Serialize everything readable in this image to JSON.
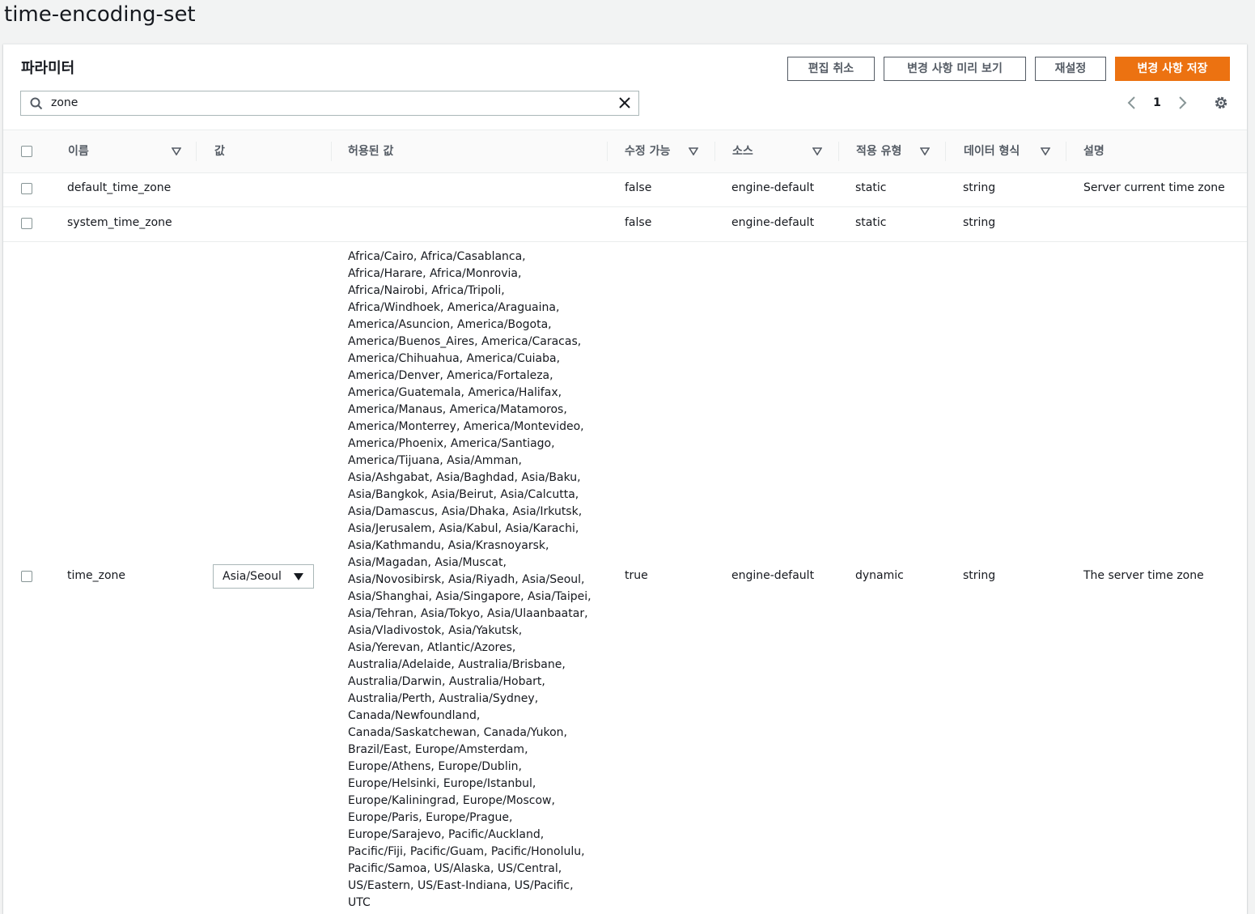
{
  "page": {
    "title": "time-encoding-set"
  },
  "panel": {
    "title": "파라미터",
    "buttons": {
      "cancel_edit": "편집 취소",
      "preview_changes": "변경 사항 미리 보기",
      "reset": "재설정",
      "save_changes": "변경 사항 저장"
    },
    "search": {
      "value": "zone",
      "icon": "search-icon",
      "clear_icon": "close-icon"
    },
    "pagination": {
      "current_page": "1"
    },
    "colors": {
      "primary": "#ec7211",
      "border": "#aab7b8",
      "header_bg": "#fafafa"
    }
  },
  "table": {
    "columns": {
      "name": "이름",
      "value": "값",
      "allowed_values": "허용된 값",
      "modifiable": "수정 가능",
      "source": "소스",
      "apply_type": "적용 유형",
      "data_type": "데이터 형식",
      "description": "설명"
    },
    "rows": [
      {
        "name": "default_time_zone",
        "value": "",
        "allowed_values": [],
        "modifiable": "false",
        "source": "engine-default",
        "apply_type": "static",
        "data_type": "string",
        "description": "Server current time zone"
      },
      {
        "name": "system_time_zone",
        "value": "",
        "allowed_values": [],
        "modifiable": "false",
        "source": "engine-default",
        "apply_type": "static",
        "data_type": "string",
        "description": ""
      },
      {
        "name": "time_zone",
        "value": "Asia/Seoul",
        "allowed_values": [
          "Africa/Cairo, Africa/Casablanca,",
          "Africa/Harare, Africa/Monrovia,",
          "Africa/Nairobi, Africa/Tripoli,",
          "Africa/Windhoek, America/Araguaina,",
          "America/Asuncion, America/Bogota,",
          "America/Buenos_Aires, America/Caracas,",
          "America/Chihuahua, America/Cuiaba,",
          "America/Denver, America/Fortaleza,",
          "America/Guatemala, America/Halifax,",
          "America/Manaus, America/Matamoros,",
          "America/Monterrey, America/Montevideo,",
          "America/Phoenix, America/Santiago,",
          "America/Tijuana, Asia/Amman,",
          "Asia/Ashgabat, Asia/Baghdad, Asia/Baku,",
          "Asia/Bangkok, Asia/Beirut, Asia/Calcutta,",
          "Asia/Damascus, Asia/Dhaka, Asia/Irkutsk,",
          "Asia/Jerusalem, Asia/Kabul, Asia/Karachi,",
          "Asia/Kathmandu, Asia/Krasnoyarsk,",
          "Asia/Magadan, Asia/Muscat,",
          "Asia/Novosibirsk, Asia/Riyadh, Asia/Seoul,",
          "Asia/Shanghai, Asia/Singapore, Asia/Taipei,",
          "Asia/Tehran, Asia/Tokyo, Asia/Ulaanbaatar,",
          "Asia/Vladivostok, Asia/Yakutsk,",
          "Asia/Yerevan, Atlantic/Azores,",
          "Australia/Adelaide, Australia/Brisbane,",
          "Australia/Darwin, Australia/Hobart,",
          "Australia/Perth, Australia/Sydney,",
          "Canada/Newfoundland,",
          "Canada/Saskatchewan, Canada/Yukon,",
          "Brazil/East, Europe/Amsterdam,",
          "Europe/Athens, Europe/Dublin,",
          "Europe/Helsinki, Europe/Istanbul,",
          "Europe/Kaliningrad, Europe/Moscow,",
          "Europe/Paris, Europe/Prague,",
          "Europe/Sarajevo, Pacific/Auckland,",
          "Pacific/Fiji, Pacific/Guam, Pacific/Honolulu,",
          "Pacific/Samoa, US/Alaska, US/Central,",
          "US/Eastern, US/East-Indiana, US/Pacific,",
          "UTC"
        ],
        "modifiable": "true",
        "source": "engine-default",
        "apply_type": "dynamic",
        "data_type": "string",
        "description": "The server time zone"
      }
    ]
  }
}
